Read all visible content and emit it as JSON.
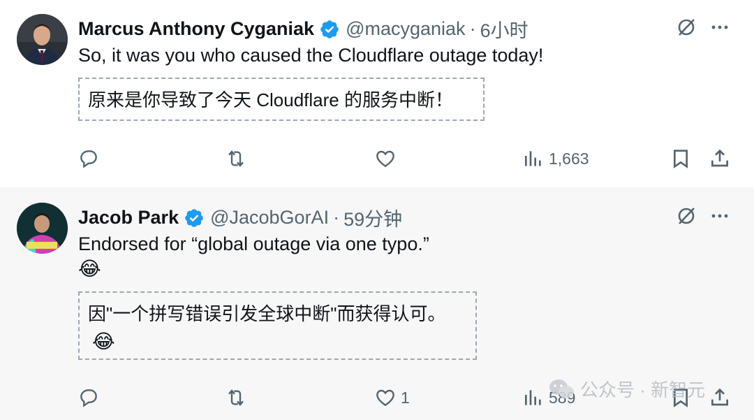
{
  "tweets": [
    {
      "author": {
        "name": "Marcus Anthony Cyganiak",
        "handle": "@macyganiak",
        "verified": true
      },
      "time": "6小时",
      "separator": "·",
      "text": "So, it was you who caused the Cloudflare outage today!",
      "translation": "原来是你导致了今天 Cloudflare 的服务中断！",
      "stats": {
        "replies": "",
        "retweets": "",
        "likes": "",
        "views": "1,663"
      }
    },
    {
      "author": {
        "name": "Jacob Park",
        "handle": "@JacobGorAI",
        "verified": true
      },
      "time": "59分钟",
      "separator": "·",
      "text": "Endorsed for “global outage via one typo.”",
      "emoji": "😂",
      "translation": "因\"一个拼写错误引发全球中断\"而获得认可。",
      "translation_emoji": "😂",
      "stats": {
        "replies": "",
        "retweets": "",
        "likes": "1",
        "views": "589"
      }
    }
  ],
  "watermark": {
    "text": "公众号 · 新智元",
    "icon": "wechat-icon"
  },
  "colors": {
    "text": "#0f1419",
    "secondary": "#536471",
    "verified": "#1d9bf0",
    "border": "#9aa7b5"
  },
  "icons": [
    "verified-badge-icon",
    "grok-icon",
    "more-icon",
    "reply-icon",
    "retweet-icon",
    "like-icon",
    "views-icon",
    "bookmark-icon",
    "share-icon"
  ]
}
